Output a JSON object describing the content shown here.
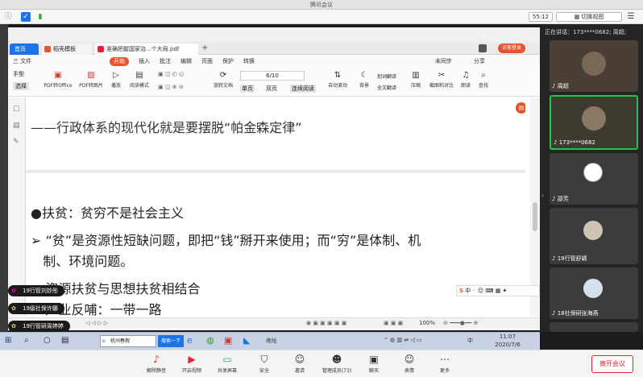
{
  "window": {
    "title": "腾讯会议"
  },
  "topbar": {
    "timer": "55:12",
    "switch_view": "切换视图"
  },
  "pdf_app": {
    "tabs": [
      {
        "label": "首页"
      },
      {
        "label": "稻壳模板"
      },
      {
        "label": "准确把握国家治...个大局.pdf"
      }
    ],
    "add_tab": "+",
    "login_badge": "访客登录",
    "menu": {
      "file": "三 文件",
      "start": "开始",
      "items": [
        "插入",
        "批注",
        "编辑",
        "页面",
        "保护",
        "转换"
      ],
      "sync": "未同步",
      "share": "分享"
    },
    "ribbon": {
      "hand": "手型",
      "select": "选择",
      "buttons": [
        "PDF转Office",
        "PDF转图片",
        "播放",
        "阅读模式",
        "旋转文档",
        "自动滚动",
        "背景",
        "划词翻译",
        "全文翻译",
        "压缩",
        "截图和对比",
        "朗读",
        "查找"
      ],
      "page_indicator": "6/10",
      "single": "单页",
      "double": "双页",
      "continuous": "连续阅读"
    },
    "document": {
      "line1": "——行政体系的现代化就是要摆脱“帕金森定律”",
      "line2": "●扶贫：贫穷不是社会主义",
      "line3a": "➢ “贫”是资源性短缺问题，即把“钱”掰开来使用；而“穷”是体制、机",
      "line3b": "   制、环境问题。",
      "line4": "➢ 资源扶贫与思想扶贫相结合",
      "line5": "➢ 产业反哺：一带一路"
    },
    "status": {
      "zoom": "100%"
    }
  },
  "panel": {
    "speaking": "正在讲话：173****0682; 周超;",
    "participants": [
      {
        "name": "周超"
      },
      {
        "name": "173****0682"
      },
      {
        "name": "邵芳"
      },
      {
        "name": "19行管舒颖"
      },
      {
        "name": "18社保研张海燕"
      }
    ]
  },
  "chat": [
    "19行管刘妙彤",
    "19级社保许娜",
    "19行管研周婷婷"
  ],
  "taskbar": {
    "search_text": "机州春假",
    "search_btn": "搜索一下",
    "address": "地址",
    "time": "11:07",
    "date": "2020/7/6",
    "lang": "中"
  },
  "bottom": {
    "buttons": [
      "解除静音",
      "开启视频",
      "共享屏幕",
      "安全",
      "邀请",
      "管理成员(73)",
      "聊天",
      "表情",
      "更多"
    ],
    "end": "离开会议"
  },
  "colors": {
    "accent": "#e8532f",
    "brand_blue": "#1a73e8",
    "end_red": "#e62e2e"
  }
}
